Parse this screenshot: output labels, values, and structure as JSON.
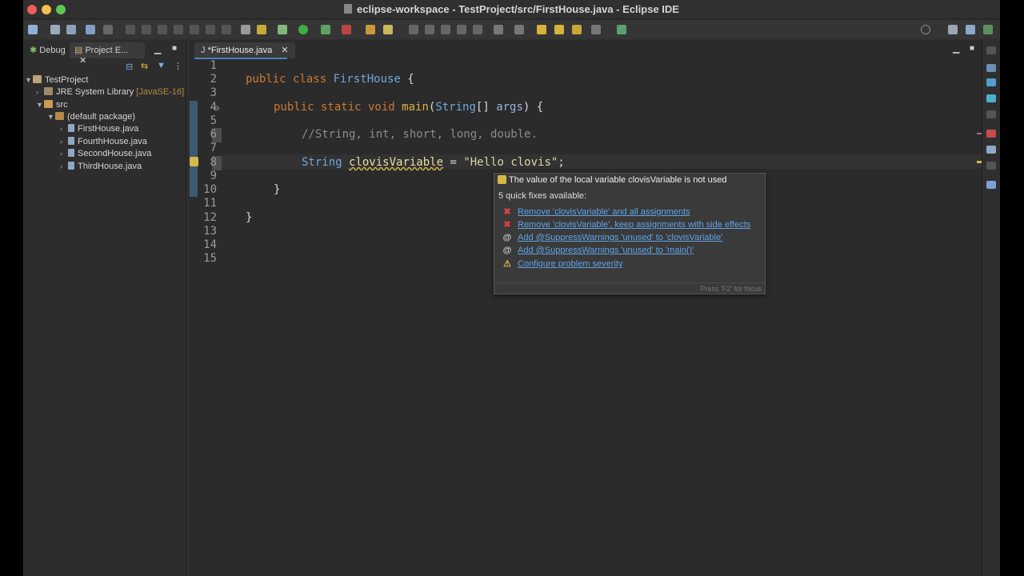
{
  "window": {
    "title": "eclipse-workspace - TestProject/src/FirstHouse.java - Eclipse IDE"
  },
  "left_panel": {
    "tabs": [
      {
        "label": "Debug",
        "icon": "bug-icon"
      },
      {
        "label": "Project E...",
        "icon": "project-explorer-icon"
      }
    ],
    "tree": [
      {
        "label": "TestProject",
        "icon": "project-icon",
        "level": 0,
        "expanded": true
      },
      {
        "label": "JRE System Library",
        "suffix": "[JavaSE-16]",
        "icon": "library-icon",
        "level": 1,
        "expanded": false
      },
      {
        "label": "src",
        "icon": "source-folder-icon",
        "level": 1,
        "expanded": true
      },
      {
        "label": "(default package)",
        "icon": "package-icon",
        "level": 2,
        "expanded": true
      },
      {
        "label": "FirstHouse.java",
        "icon": "java-file-icon",
        "level": 3,
        "expanded": false
      },
      {
        "label": "FourthHouse.java",
        "icon": "java-file-icon",
        "level": 3,
        "expanded": false
      },
      {
        "label": "SecondHouse.java",
        "icon": "java-file-icon",
        "level": 3,
        "expanded": false
      },
      {
        "label": "ThirdHouse.java",
        "icon": "java-file-icon",
        "level": 3,
        "expanded": false
      }
    ]
  },
  "editor": {
    "tab_label": "*FirstHouse.java",
    "line_numbers": [
      "1",
      "2",
      "3",
      "4",
      "5",
      "6",
      "7",
      "8",
      "9",
      "10",
      "11",
      "12",
      "13",
      "14",
      "15"
    ],
    "code": {
      "l2_kw": "public class ",
      "l2_cls": "FirstHouse",
      "l2_rest": " {",
      "l4_kw": "public static void ",
      "l4_fn": "main",
      "l4_open": "(",
      "l4_cls": "String",
      "l4_mid": "[] ",
      "l4_prm": "args",
      "l4_rest": ") {",
      "l6_cmt": "//String, int, short, long, double.",
      "l8_cls": "String ",
      "l8_var": "clovisVariable",
      "l8_eq": " = ",
      "l8_str": "\"Hello clovis\"",
      "l8_end": ";",
      "l10": "}",
      "l12": "}"
    }
  },
  "hover": {
    "title": "The value of the local variable clovisVariable is not used",
    "count": "5 quick fixes available:",
    "fixes": [
      {
        "label": "Remove 'clovisVariable' and all assignments",
        "icon": "remove-icon"
      },
      {
        "label": "Remove 'clovisVariable', keep assignments with side effects",
        "icon": "remove-icon"
      },
      {
        "label": "Add @SuppressWarnings 'unused' to 'clovisVariable'",
        "icon": "annotation-icon"
      },
      {
        "label": "Add @SuppressWarnings 'unused' to 'main()'",
        "icon": "annotation-icon"
      },
      {
        "label": "Configure problem severity",
        "icon": "configure-icon"
      }
    ],
    "footer": "Press 'F2' for focus"
  },
  "colors": {
    "traffic_close": "#ee5c57",
    "traffic_min": "#f5be4f",
    "traffic_max": "#5fc553",
    "warning": "#d4b84a",
    "error": "#d94343",
    "link": "#5fa3e8"
  }
}
